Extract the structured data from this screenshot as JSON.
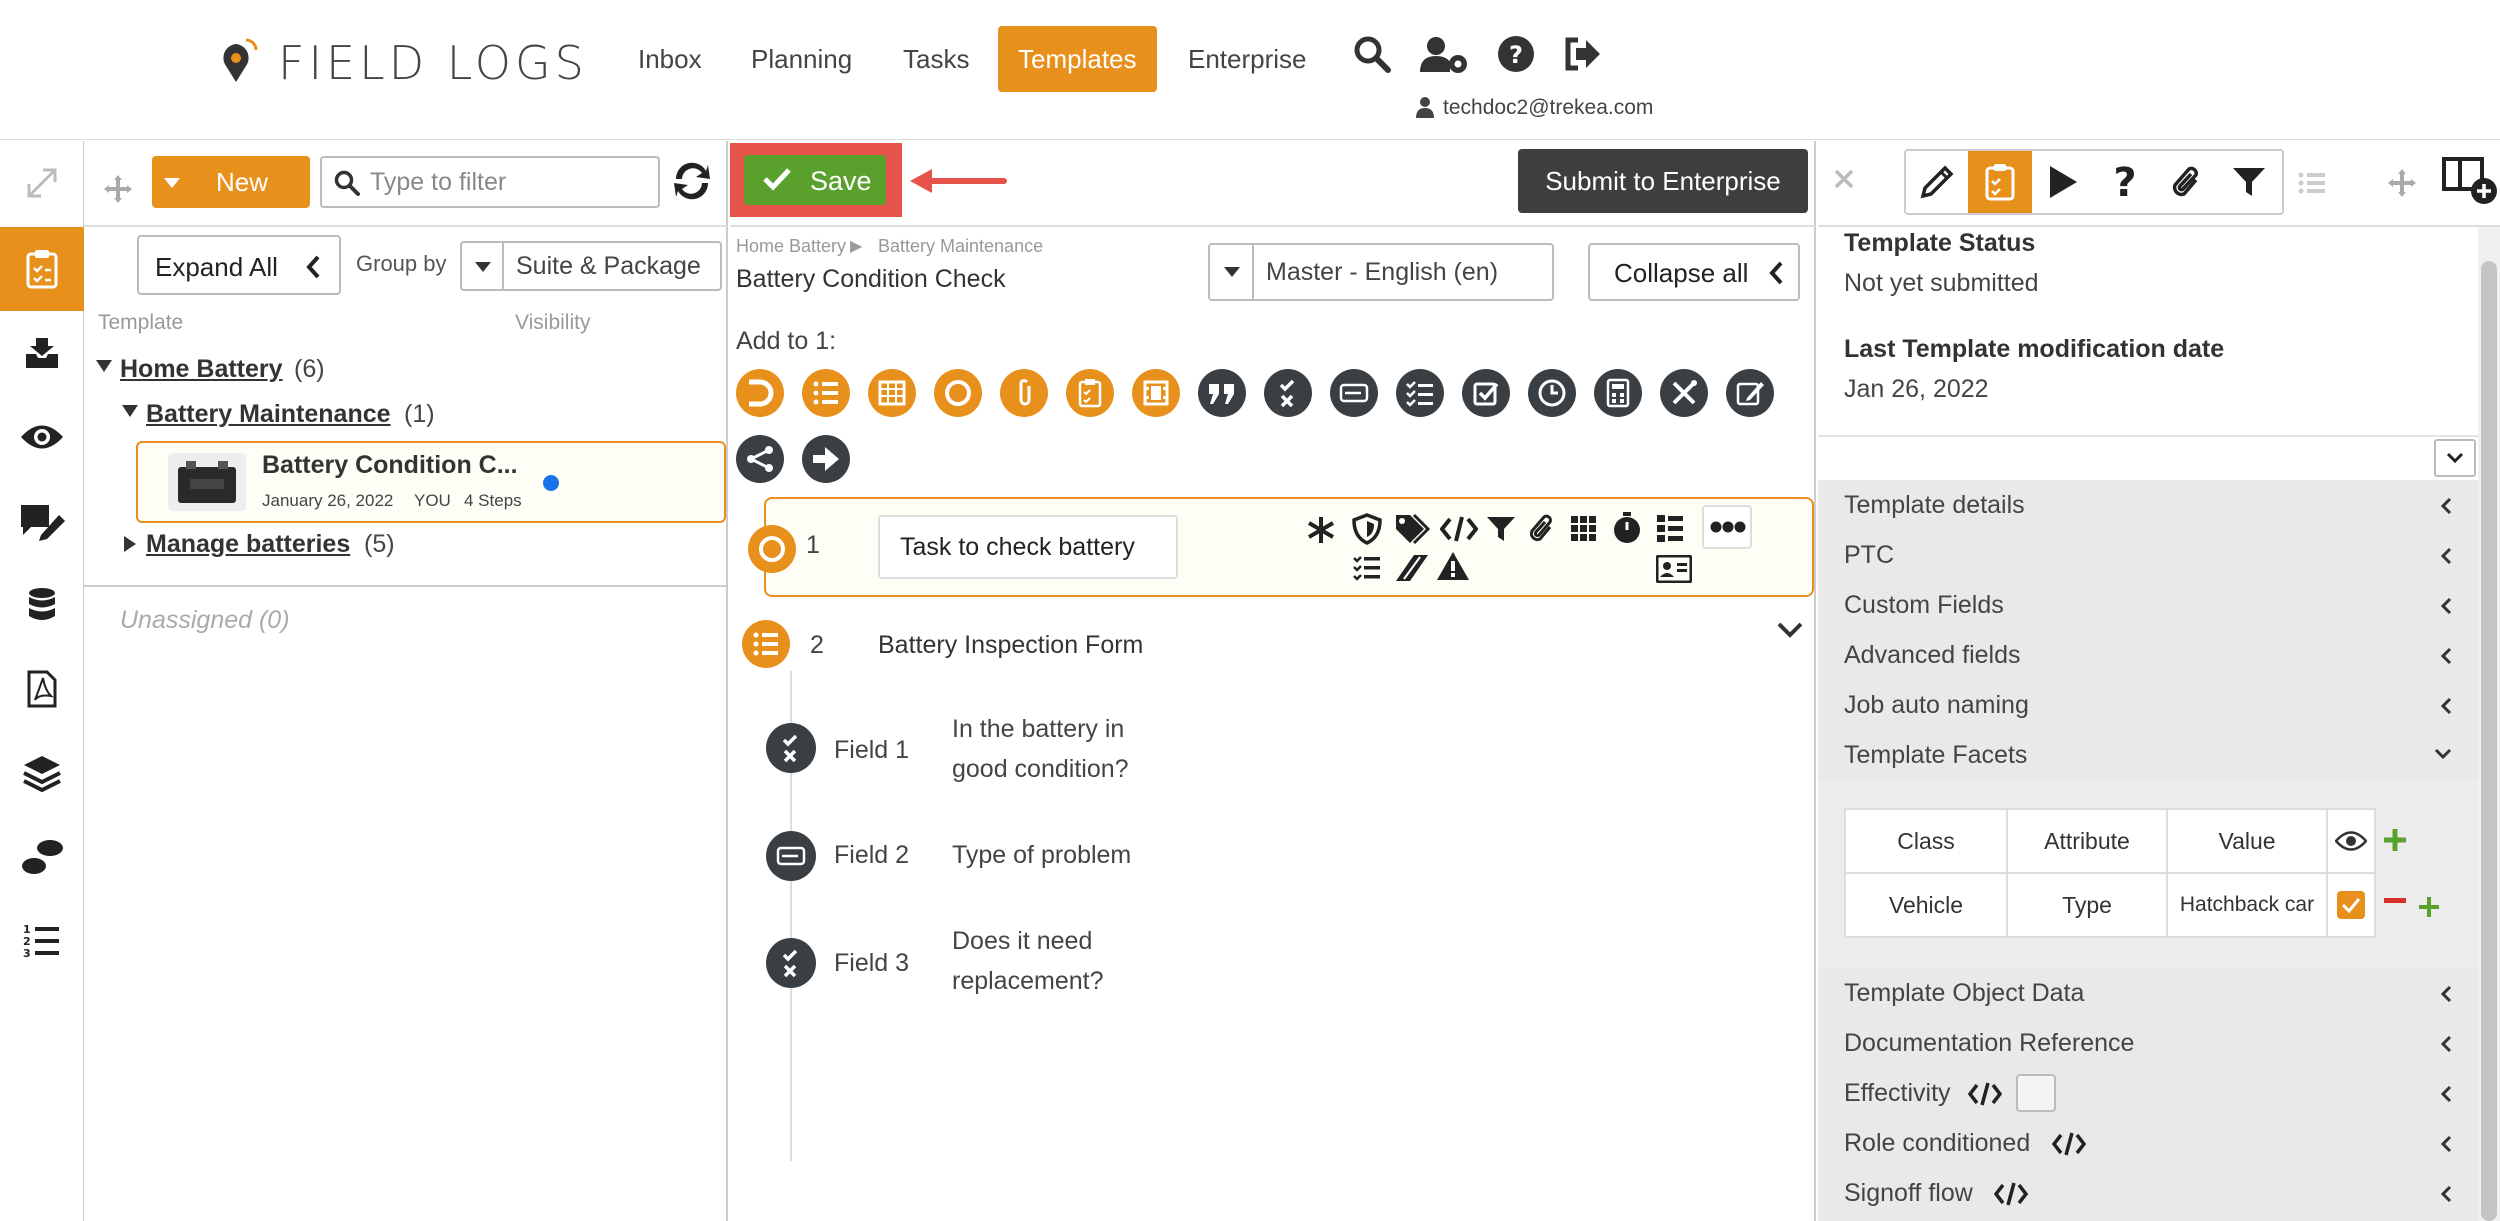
{
  "header": {
    "logo": "FIELD LOGS",
    "nav": [
      "Inbox",
      "Planning",
      "Tasks",
      "Templates",
      "Enterprise"
    ],
    "active_nav": "Templates",
    "user": "techdoc2@trekea.com"
  },
  "left_panel": {
    "new_label": "New",
    "filter_placeholder": "Type to filter",
    "expand_all": "Expand All",
    "group_by_label": "Group by",
    "group_by_value": "Suite & Package",
    "col_template": "Template",
    "col_visibility": "Visibility",
    "tree": {
      "home_battery": "Home Battery",
      "home_battery_count": "(6)",
      "battery_maintenance": "Battery Maintenance",
      "battery_maintenance_count": "(1)",
      "selected_title": "Battery Condition C...",
      "selected_date": "January 26, 2022",
      "selected_owner": "YOU",
      "selected_steps": "4 Steps",
      "manage_batteries": "Manage batteries",
      "manage_batteries_count": "(5)",
      "unassigned": "Unassigned (0)"
    }
  },
  "center": {
    "save_label": "Save",
    "submit_label": "Submit to Enterprise",
    "breadcrumb_1": "Home Battery",
    "breadcrumb_sep": "▶",
    "breadcrumb_2": "Battery Maintenance",
    "template_title": "Battery Condition Check",
    "language": "Master - English (en)",
    "collapse_all": "Collapse all",
    "add_to": "Add to 1:",
    "step1_num": "1",
    "step1_label": "Task to check battery",
    "step2_num": "2",
    "step2_label": "Battery Inspection Form",
    "fields": [
      {
        "name": "Field 1",
        "text1": "In the battery in",
        "text2": "good condition?"
      },
      {
        "name": "Field 2",
        "text1": "Type of problem",
        "text2": ""
      },
      {
        "name": "Field 3",
        "text1": "Does it need",
        "text2": "replacement?"
      }
    ]
  },
  "right_panel": {
    "status_title": "Template Status",
    "status_value": "Not yet submitted",
    "mod_title": "Last Template modification date",
    "mod_value": "Jan 26, 2022",
    "sections": [
      "Template details",
      "PTC",
      "Custom Fields",
      "Advanced fields",
      "Job auto naming",
      "Template Facets"
    ],
    "sections_after": [
      "Template Object Data",
      "Documentation Reference",
      "Effectivity",
      "Role conditioned",
      "Signoff flow"
    ],
    "facets": {
      "headers": [
        "Class",
        "Attribute",
        "Value"
      ],
      "row": [
        "Vehicle",
        "Type",
        "Hatchback car"
      ]
    }
  },
  "colors": {
    "accent": "#e8901c",
    "save_green": "#5aa02c",
    "dark": "#3a3f44",
    "highlight_red": "#e5534b"
  }
}
